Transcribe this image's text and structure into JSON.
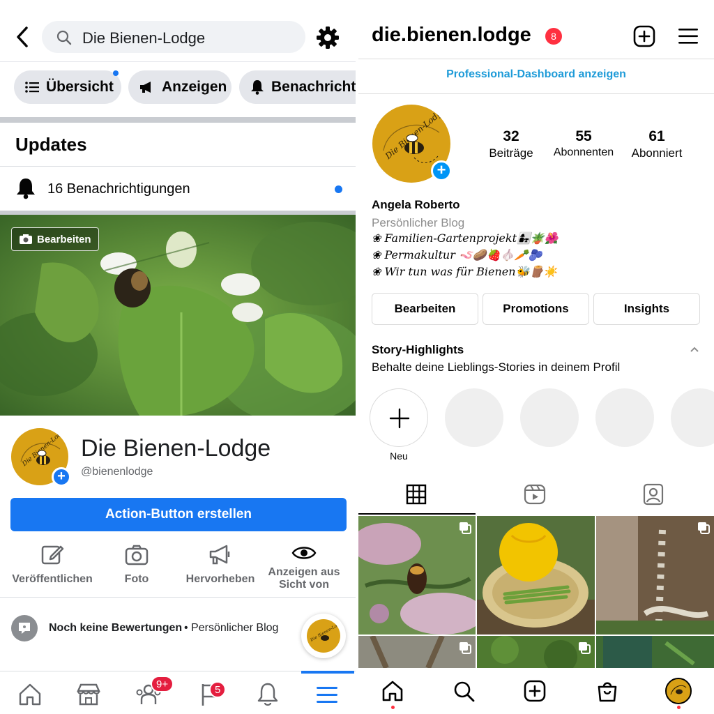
{
  "facebook": {
    "search_text": "Die Bienen-Lodge",
    "chips": [
      {
        "label": "Übersicht"
      },
      {
        "label": "Anzeigen"
      },
      {
        "label": "Benachrichtigungen"
      }
    ],
    "updates_title": "Updates",
    "notifications_label": "16 Benachrichtigungen",
    "cover_edit_label": "Bearbeiten",
    "page_name": "Die Bienen-Lodge",
    "page_handle": "@bienenlodge",
    "action_button_label": "Action-Button erstellen",
    "tools": [
      {
        "label": "Veröffentlichen",
        "icon": "compose-icon"
      },
      {
        "label": "Foto",
        "icon": "camera-icon"
      },
      {
        "label": "Hervorheben",
        "icon": "megaphone-icon"
      },
      {
        "label": "Anzeigen aus Sicht von",
        "icon": "eye-icon"
      }
    ],
    "reviews_label": "Noch keine Bewertungen",
    "reviews_category": "• Persönlicher Blog",
    "avatar_logo_text": "Die Bienen-Lodge",
    "nav": [
      {
        "icon": "home-icon"
      },
      {
        "icon": "marketplace-icon"
      },
      {
        "icon": "groups-icon",
        "badge": "9+"
      },
      {
        "icon": "pages-flag-icon",
        "badge": "5"
      },
      {
        "icon": "bell-icon"
      },
      {
        "icon": "menu-icon",
        "active": true
      }
    ],
    "accent_color": "#1877f2"
  },
  "instagram": {
    "username": "die.bienen.lodge",
    "notification_badge": "8",
    "dashboard_link": "Professional-Dashboard anzeigen",
    "stats": [
      {
        "value": "32",
        "label": "Beiträge"
      },
      {
        "value": "55",
        "label": "Abonnenten"
      },
      {
        "value": "61",
        "label": "Abonniert"
      }
    ],
    "display_name": "Angela Roberto",
    "category": "Persönlicher Blog",
    "bio": [
      "❀ Familien-Gartenprojekt👩‍👧🪴🌺",
      "❀ Permakultur 🪱🥔🍓🧄🥕🫐",
      "❀ Wir tun was für Bienen🐝🪵☀️"
    ],
    "buttons": [
      "Bearbeiten",
      "Promotions",
      "Insights"
    ],
    "highlights_title": "Story-Highlights",
    "highlights_subtitle": "Behalte deine Lieblings-Stories in deinem Profil",
    "new_highlight_label": "Neu",
    "tabs": [
      {
        "icon": "grid-icon",
        "active": true
      },
      {
        "icon": "reels-icon"
      },
      {
        "icon": "tagged-icon"
      }
    ],
    "nav": [
      {
        "icon": "home-icon"
      },
      {
        "icon": "search-icon"
      },
      {
        "icon": "create-icon"
      },
      {
        "icon": "shop-icon"
      },
      {
        "icon": "profile-avatar"
      }
    ],
    "accent_color": "#0095f6"
  }
}
